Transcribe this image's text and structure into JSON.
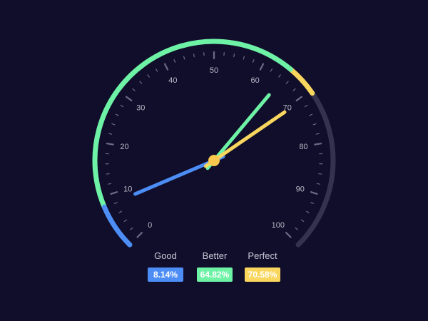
{
  "gauge": {
    "min": 0,
    "max": 100,
    "tick_labels": [
      "0",
      "10",
      "20",
      "30",
      "40",
      "50",
      "60",
      "70",
      "80",
      "90",
      "100"
    ],
    "track_color": "#35324f",
    "tick_color": "#6d6b84"
  },
  "segments": [
    {
      "from": 0,
      "to": 8.14,
      "color": "#4d8ef6"
    },
    {
      "from": 8.14,
      "to": 64.82,
      "color": "#6ef2a6"
    },
    {
      "from": 64.82,
      "to": 70.58,
      "color": "#f9d65e"
    }
  ],
  "legend": [
    {
      "name": "Good",
      "value": "8.14%",
      "number": 8.14,
      "color": "#4d8ef6"
    },
    {
      "name": "Better",
      "value": "64.82%",
      "number": 64.82,
      "color": "#6ef2a6"
    },
    {
      "name": "Perfect",
      "value": "70.58%",
      "number": 70.58,
      "color": "#f9d65e"
    }
  ],
  "pointers": [
    {
      "name": "Good",
      "value": 8.14,
      "color": "#4d8ef6"
    },
    {
      "name": "Better",
      "value": 64.82,
      "color": "#6ef2a6"
    },
    {
      "name": "Perfect",
      "value": 70.58,
      "color": "#f9d65e"
    }
  ],
  "hub_color": "#f9c84e"
}
